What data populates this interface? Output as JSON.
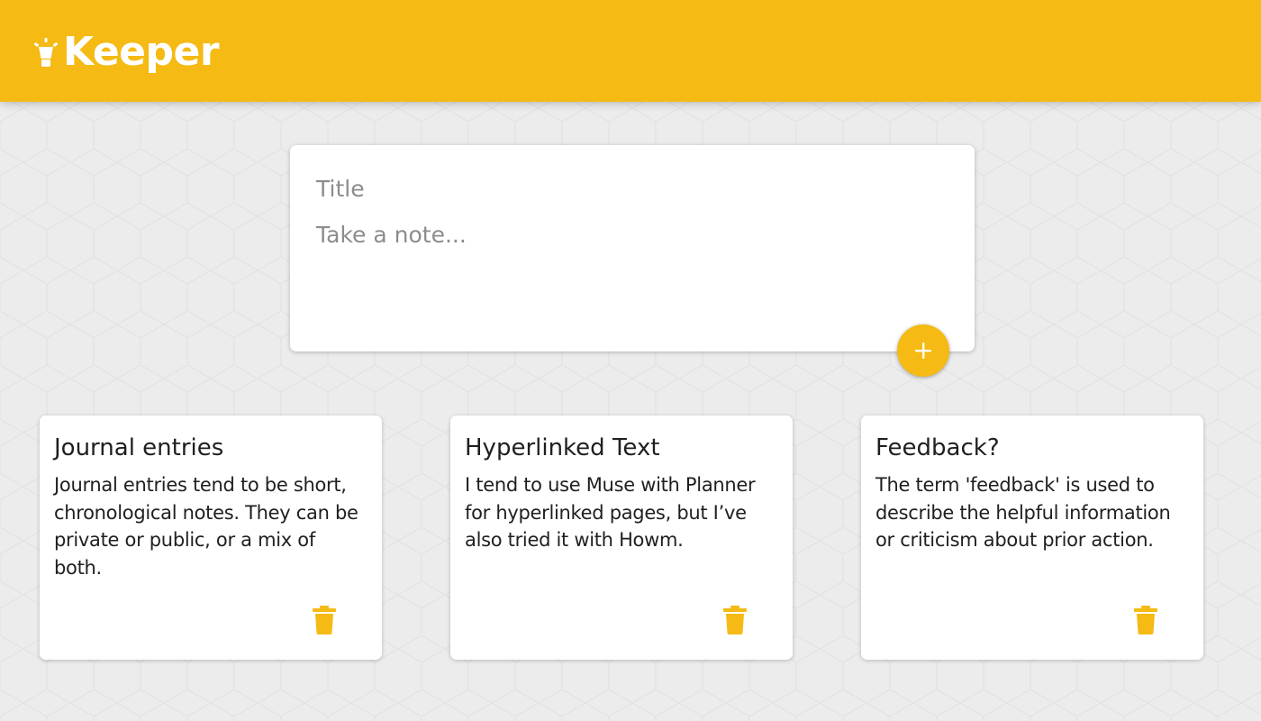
{
  "app": {
    "title": "Keeper"
  },
  "colors": {
    "accent": "#f5ba13",
    "background": "#ececec",
    "card": "#ffffff",
    "text": "#1f1f1f",
    "placeholder": "#8c8c8c"
  },
  "icons": {
    "logo": "lightbulb-icon",
    "add": "plus-icon",
    "delete": "trash-icon"
  },
  "create_note": {
    "title_placeholder": "Title",
    "content_placeholder": "Take a note...",
    "title_value": "",
    "content_value": ""
  },
  "notes": [
    {
      "title": "Journal entries",
      "content": "Journal entries tend to be short, chronological notes. They can be private or public, or a mix of both."
    },
    {
      "title": "Hyperlinked Text",
      "content": "I tend to use Muse with Planner for hyperlinked pages, but I’ve also tried it with Howm."
    },
    {
      "title": "Feedback?",
      "content": "The term 'feedback' is used to describe the helpful information or criticism about prior action."
    }
  ]
}
